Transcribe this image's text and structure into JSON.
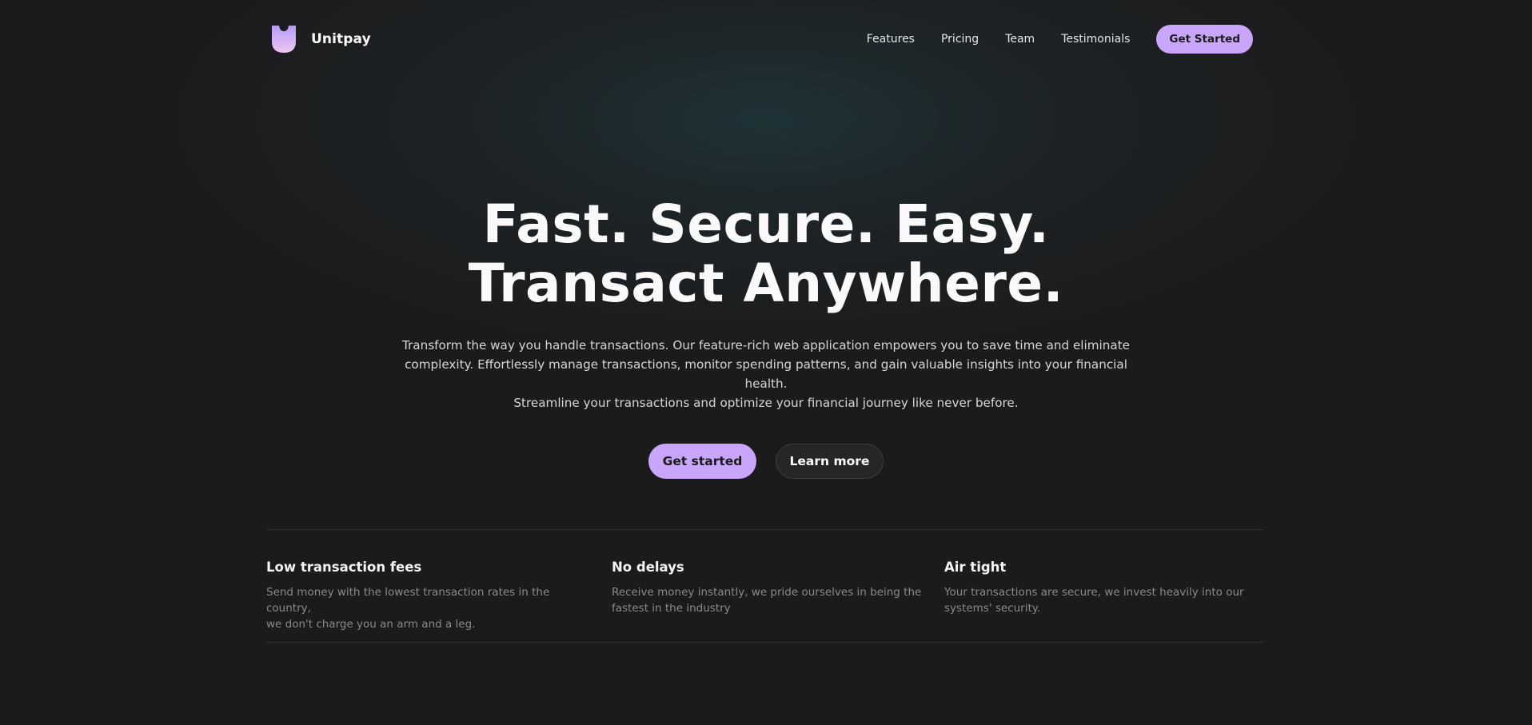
{
  "brand": {
    "name": "Unitpay",
    "logo_icon": "shield-u-logo-icon"
  },
  "nav": {
    "links": [
      "Features",
      "Pricing",
      "Team",
      "Testimonials"
    ],
    "cta_label": "Get Started"
  },
  "hero": {
    "title_line1": "Fast. Secure. Easy.",
    "title_line2": "Transact Anywhere.",
    "subtitle_line1": "Transform the way you handle transactions. Our feature-rich web application empowers you to save time and eliminate",
    "subtitle_line2": "complexity. Effortlessly manage transactions, monitor spending patterns, and gain valuable insights into your financial health.",
    "subtitle_line3": "Streamline your transactions and optimize your financial journey like never before.",
    "primary_cta": "Get started",
    "secondary_cta": "Learn more"
  },
  "features": [
    {
      "title": "Low transaction fees",
      "desc_line1": "Send money with the lowest transaction rates in the country,",
      "desc_line2": "we don't charge you an arm and a leg."
    },
    {
      "title": "No delays",
      "desc_line1": "Receive money instantly, we pride ourselves in being the",
      "desc_line2": "fastest in the industry"
    },
    {
      "title": "Air tight",
      "desc_line1": "Your transactions are secure, we invest heavily into our",
      "desc_line2": "systems' security."
    }
  ],
  "colors": {
    "background": "#1b1b1c",
    "accent": "#c9a6fb",
    "logo_gradient_top": "#b59cf8",
    "logo_gradient_bottom": "#f0c6f4",
    "muted_text": "#8a8a8c"
  }
}
